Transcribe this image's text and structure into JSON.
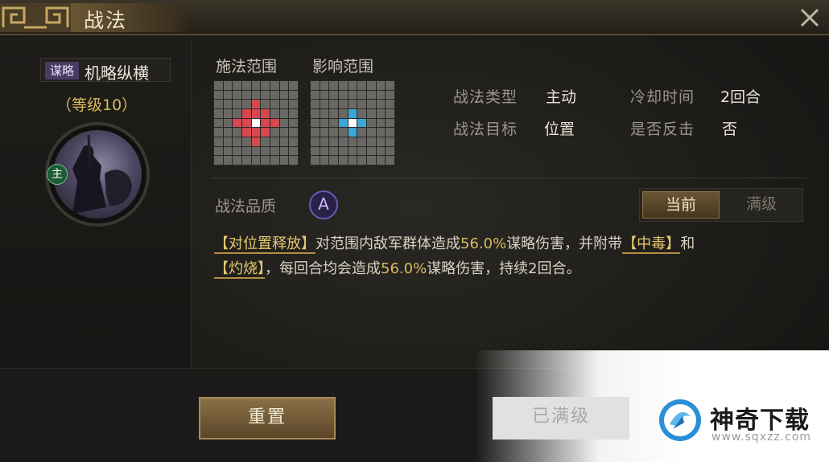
{
  "window": {
    "title": "战法"
  },
  "skill": {
    "tag": "谋略",
    "name": "机略纵横",
    "level": "（等级10）",
    "role_badge": "主"
  },
  "range": {
    "cast_label": "施法范围",
    "effect_label": "影响范围",
    "cast_color": "#d8474e",
    "effect_color": "#3aa7d6",
    "center_color": "#ffffff"
  },
  "attributes": {
    "type_label": "战法类型",
    "type_value": "主动",
    "cooldown_label": "冷却时间",
    "cooldown_value": "2回合",
    "target_label": "战法目标",
    "target_value": "位置",
    "counter_label": "是否反击",
    "counter_value": "否"
  },
  "quality": {
    "label": "战法品质",
    "grade": "A"
  },
  "level_toggle": {
    "current": "当前",
    "max": "满级"
  },
  "description": {
    "p1": "【对位置释放】",
    "p2": "对范围内敌军群体造成",
    "p3": "56.0%",
    "p4": "谋略伤害，并附带",
    "p5": "【中毒】",
    "p6": "和",
    "p7": "【灼烧】",
    "p8": "，每回合均会造成",
    "p9": "56.0%",
    "p10": "谋略伤害，持续2回合。"
  },
  "buttons": {
    "reset": "重置",
    "maxed": "已满级"
  },
  "watermark": {
    "name": "神奇下载",
    "url": "www.sqxzz.com"
  },
  "colors": {
    "gold": "#d9b95c",
    "grade_purple": "#6b58b8"
  }
}
